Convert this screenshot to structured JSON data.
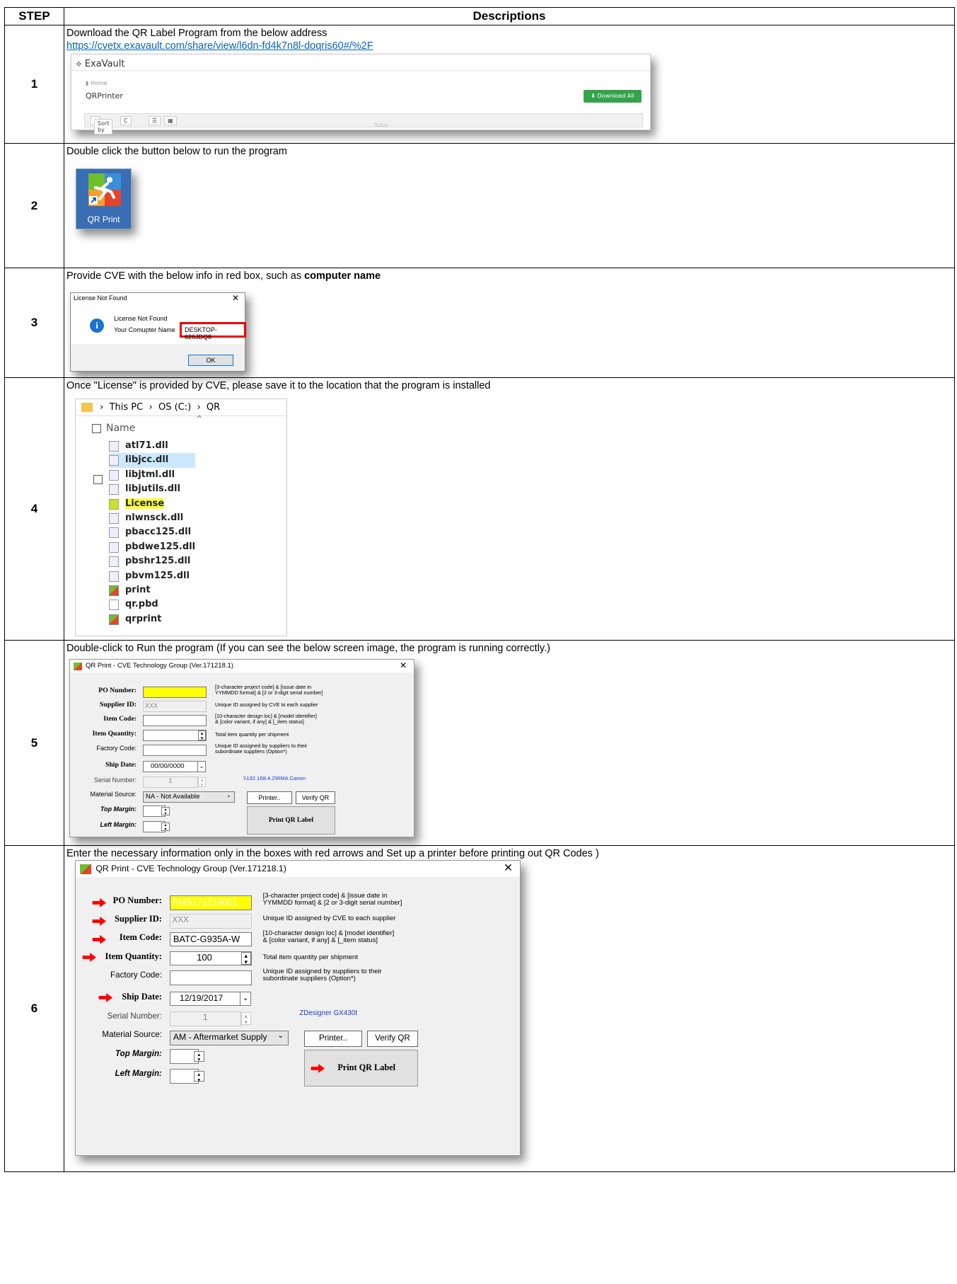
{
  "table": {
    "col_step": "STEP",
    "col_desc": "Descriptions"
  },
  "steps": [
    {
      "num": "1",
      "text": "Download the QR Label Program from the below address",
      "link": "https://cvetx.exavault.com/share/view/l6dn-fd4k7n8l-doqris60#/%2F"
    },
    {
      "num": "2",
      "text": "Double click the button below to run the program"
    },
    {
      "num": "3",
      "text_before": "Provide CVE with the below info in red box, such as ",
      "text_bold": "computer name"
    },
    {
      "num": "4",
      "text": "Once \"License\" is provided by CVE, please save it to the location that the program is installed"
    },
    {
      "num": "5",
      "text": "Double-click to Run the program (If you can see the below screen image, the program is running correctly.)"
    },
    {
      "num": "6",
      "text": "Enter the necessary information only in the boxes with red arrows and Set up a printer before printing out QR Codes )"
    }
  ],
  "exavault": {
    "logo": "ExaVault",
    "crumb": "Home",
    "folder": "QRPrinter",
    "download": "Download All",
    "sort": "Sort by",
    "today": "Today"
  },
  "qr_app_icon": {
    "label": "QR Print"
  },
  "license_dialog": {
    "title": "License Not Found",
    "message": "License Not Found",
    "computer_label": "Your Comupter Name",
    "computer_name": "DESKTOP-626JDQ8",
    "ok": "OK"
  },
  "explorer": {
    "path": [
      "This PC",
      "OS (C:)",
      "QR"
    ],
    "column": "Name",
    "files": [
      "atl71.dll",
      "libjcc.dll",
      "libjtml.dll",
      "libjutils.dll",
      "License",
      "nlwnsck.dll",
      "pbacc125.dll",
      "pbdwe125.dll",
      "pbshr125.dll",
      "pbvm125.dll",
      "print",
      "qr.pbd",
      "qrprint"
    ]
  },
  "qr_form": {
    "title": "QR Print - CVE Technology Group (Ver.171218.1)",
    "labels": {
      "po": "PO Number:",
      "supplier": "Supplier ID:",
      "item_code": "Item Code:",
      "item_qty": "Item Quantity:",
      "factory": "Factory Code:",
      "ship": "Ship Date:",
      "serial": "Serial Number:",
      "material": "Material Source:",
      "top": "Top Margin:",
      "left": "Left Margin:"
    },
    "hints": {
      "po": "[3-character project code] & [issue date in\nYYMMDD format] & [2 or 3-digit serial number]",
      "supplier": "Unique ID assigned by CVE to each supplier",
      "item_code": "[10-character design loc] & [model identifier]\n& [color variant, if any] & [_item status]",
      "item_qty": "Total item quantity per shipment",
      "factory": "Unique ID assigned by suppliers to their\nsubordinate suppliers (Option*)"
    },
    "buttons": {
      "printer": "Printer..",
      "verify": "Verify QR",
      "print": "Print QR Label"
    },
    "step5": {
      "po": "",
      "supplier": "XXX",
      "item_code": "",
      "item_qty": "",
      "factory": "",
      "ship": "00/00/0000",
      "serial": "1",
      "material": "NA - Not Available",
      "printer_path": "\\\\192.168.4.2\\RMA Canon"
    },
    "step6": {
      "po": "PMS171219001",
      "supplier": "XXX",
      "item_code": "BATC-G935A-W",
      "item_qty": "100",
      "factory": "",
      "ship": "12/19/2017",
      "serial": "1",
      "material": "AM - Aftermarket Supply",
      "printer_path": "ZDesigner GX430t"
    }
  },
  "colors": {
    "link": "#0563c1",
    "arrow": "#ff0000",
    "highlight": "#ffff00",
    "download": "#34a34c"
  }
}
